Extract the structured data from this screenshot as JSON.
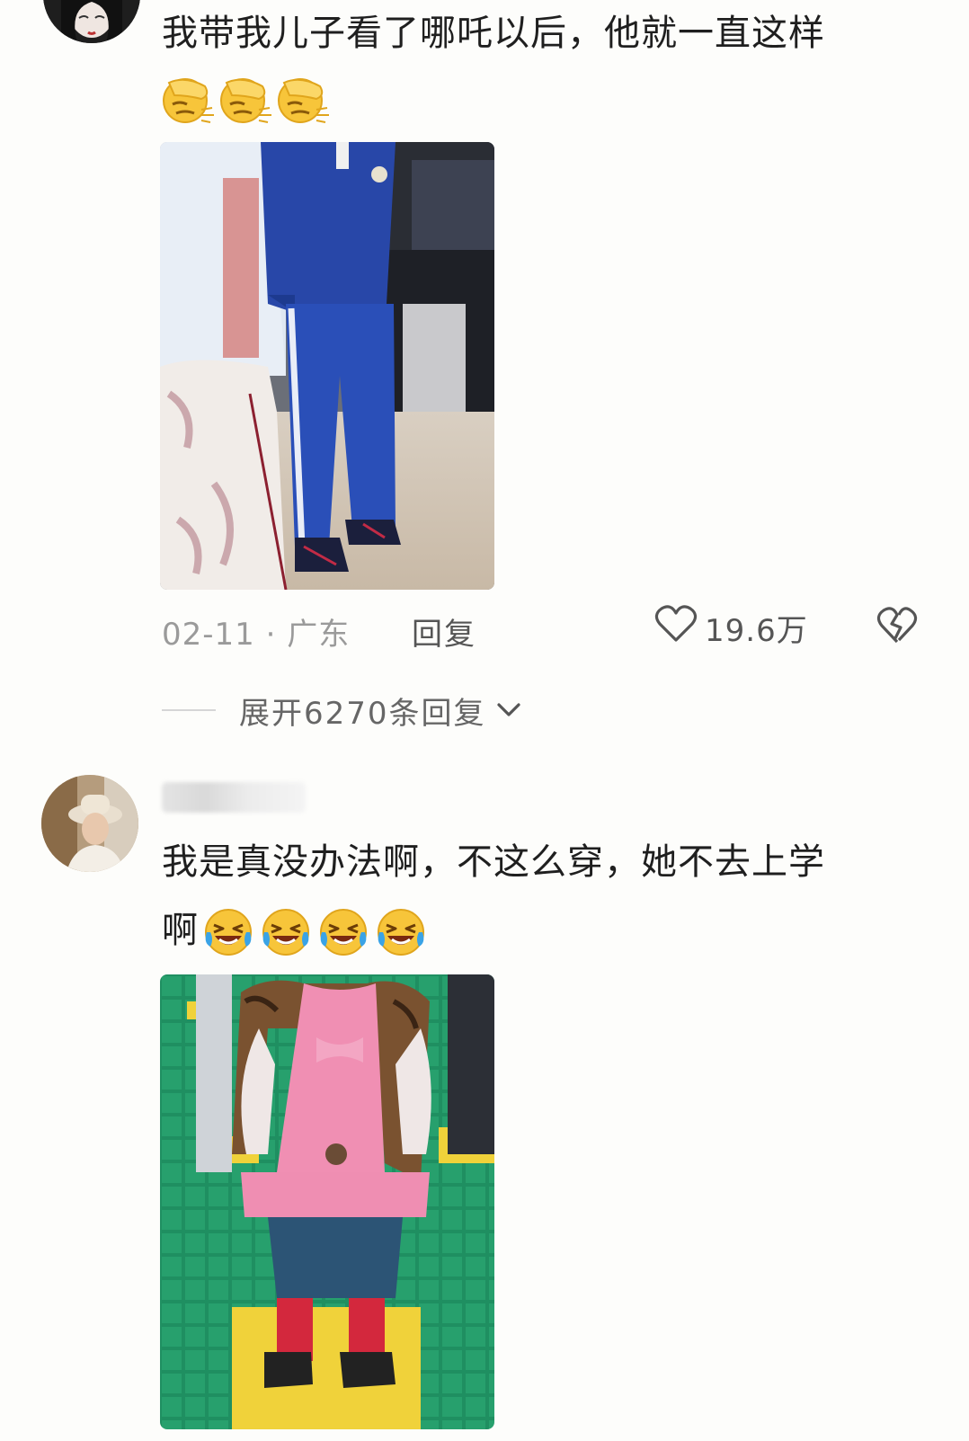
{
  "comments": [
    {
      "text": "我带我儿子看了哪吒以后，他就一直这样",
      "emojis": [
        "facepalm-emoji",
        "facepalm-emoji",
        "facepalm-emoji"
      ],
      "date": "02-11",
      "location": "广东",
      "date_location": "02-11 · 广东",
      "reply_label": "回复",
      "like_count": "19.6万",
      "expand_label": "展开6270条回复"
    },
    {
      "text": "我是真没办法啊，不这么穿，她不去上学",
      "text_line2": "啊",
      "emojis": [
        "laughing-crying-emoji",
        "laughing-crying-emoji",
        "laughing-crying-emoji",
        "laughing-crying-emoji"
      ]
    }
  ],
  "colors": {
    "text": "#1f1f1f",
    "meta": "#9a9a9a",
    "background": "#fdfdfb"
  }
}
